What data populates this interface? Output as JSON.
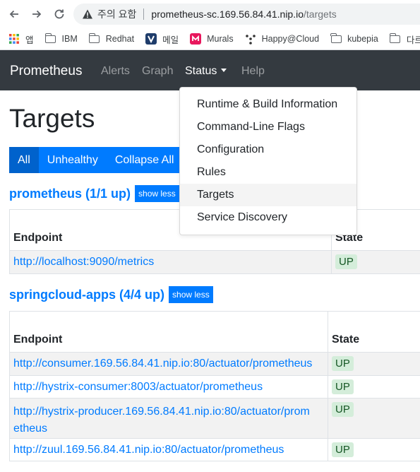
{
  "browser": {
    "security_warning": "주의 요함",
    "url_host": "prometheus-sc.169.56.84.41.nip.io",
    "url_path": "/targets",
    "bookmarks": [
      {
        "label": "앱",
        "icon": "apps-grid-icon"
      },
      {
        "label": "IBM",
        "icon": "folder-icon"
      },
      {
        "label": "Redhat",
        "icon": "folder-icon"
      },
      {
        "label": "메일",
        "icon": "mail-v-icon"
      },
      {
        "label": "Murals",
        "icon": "mural-icon"
      },
      {
        "label": "Happy@Cloud",
        "icon": "dots-icon"
      },
      {
        "label": "kubepia",
        "icon": "folder-icon"
      },
      {
        "label": "다르",
        "icon": "folder-icon"
      }
    ]
  },
  "navbar": {
    "brand": "Prometheus",
    "links": {
      "alerts": "Alerts",
      "graph": "Graph",
      "status": "Status",
      "help": "Help"
    }
  },
  "status_menu": {
    "items": [
      "Runtime & Build Information",
      "Command-Line Flags",
      "Configuration",
      "Rules",
      "Targets",
      "Service Discovery"
    ],
    "highlighted": "Targets"
  },
  "page": {
    "title": "Targets",
    "filters": {
      "all": "All",
      "unhealthy": "Unhealthy",
      "collapse": "Collapse All"
    }
  },
  "pools": [
    {
      "title": "prometheus (1/1 up)",
      "toggle": "show less",
      "headers": {
        "endpoint": "Endpoint",
        "state": "State"
      },
      "rows": [
        {
          "endpoint": "http://localhost:9090/metrics",
          "state": "UP"
        }
      ]
    },
    {
      "title": "springcloud-apps (4/4 up)",
      "toggle": "show less",
      "headers": {
        "endpoint": "Endpoint",
        "state": "State"
      },
      "rows": [
        {
          "endpoint": "http://consumer.169.56.84.41.nip.io:80/actuator/prometheus",
          "state": "UP"
        },
        {
          "endpoint": "http://hystrix-consumer:8003/actuator/prometheus",
          "state": "UP"
        },
        {
          "endpoint_line1": "http://hystrix-producer.169.56.84.41.nip.io:80/actuator/prom",
          "endpoint_line2": "etheus",
          "state": "UP"
        },
        {
          "endpoint": "http://zuul.169.56.84.41.nip.io:80/actuator/prometheus",
          "state": "UP"
        }
      ]
    }
  ],
  "colors": {
    "link": "#007bff",
    "navbar": "#343a40",
    "badge_bg": "#d4edda",
    "badge_text": "#155724"
  }
}
